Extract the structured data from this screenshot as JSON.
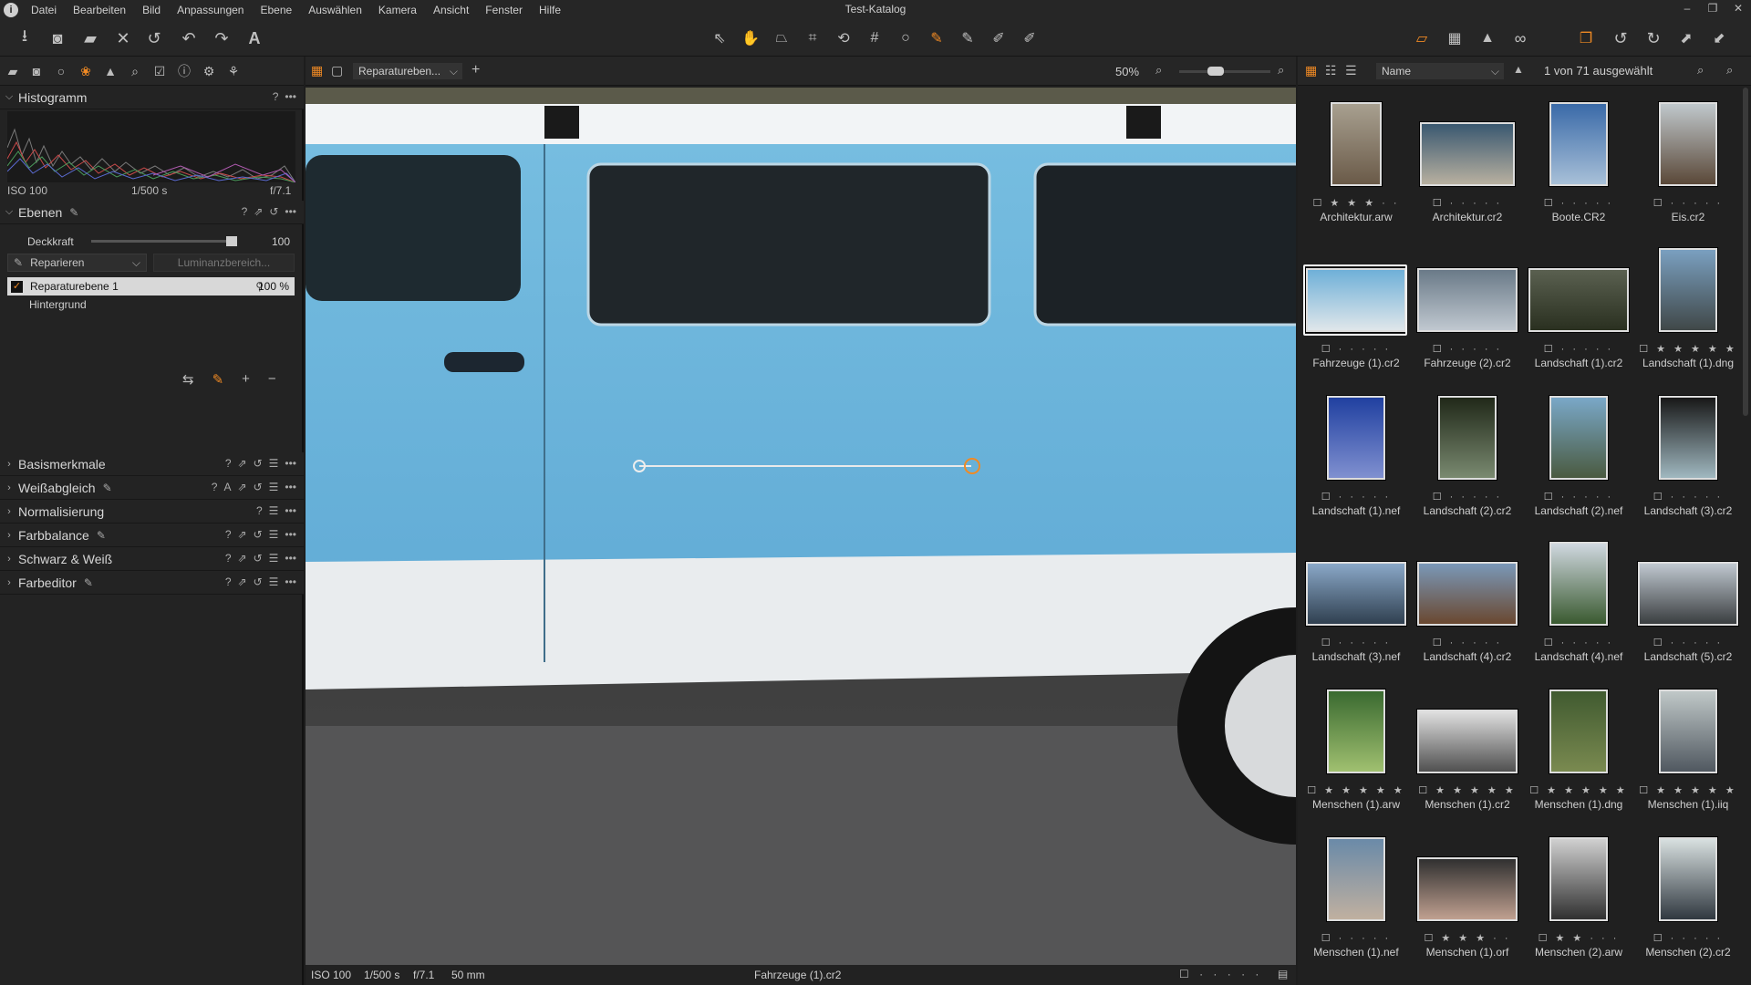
{
  "window": {
    "title": "Test-Katalog"
  },
  "menu": [
    "Datei",
    "Bearbeiten",
    "Bild",
    "Anpassungen",
    "Ebene",
    "Auswählen",
    "Kamera",
    "Ansicht",
    "Fenster",
    "Hilfe"
  ],
  "histogram": {
    "title": "Histogramm",
    "iso": "ISO 100",
    "shutter": "1/500 s",
    "aperture": "f/7.1",
    "help": "?"
  },
  "layers": {
    "title": "Ebenen",
    "opacity_label": "Deckkraft",
    "opacity_value": "100",
    "opacity_fraction": 1.0,
    "mode_select": "Reparieren",
    "luminance_button": "Luminanzbereich...",
    "items": [
      {
        "name": "Reparaturebene 1",
        "value": "100 %",
        "checked": true
      },
      {
        "name": "Hintergrund"
      }
    ]
  },
  "tools": [
    {
      "title": "Basismerkmale"
    },
    {
      "title": "Weißabgleich"
    },
    {
      "title": "Normalisierung"
    },
    {
      "title": "Farbbalance"
    },
    {
      "title": "Schwarz & Weiß"
    },
    {
      "title": "Farbeditor"
    }
  ],
  "viewer": {
    "layer_select": "Reparatureben...",
    "zoom": "50%",
    "zoom_fraction": 0.4
  },
  "status": {
    "iso": "ISO 100",
    "shutter": "1/500 s",
    "aperture": "f/7.1",
    "focal": "50 mm",
    "filename": "Fahrzeuge (1).cr2"
  },
  "browser": {
    "sort": "Name",
    "count": "1 von 71 ausgewählt"
  },
  "thumbnails": [
    {
      "name": "Architektur.arw",
      "stars": "☐ ★ ★ ★ · ·",
      "colors": [
        "#a8a090",
        "#6a5a48"
      ]
    },
    {
      "name": "Architektur.cr2",
      "stars": "☐ · · · · ·",
      "colors": [
        "#3a5870",
        "#b8b0a0"
      ]
    },
    {
      "name": "Boote.CR2",
      "stars": "☐ · · · · ·",
      "colors": [
        "#3a6aa8",
        "#a8c0d8"
      ]
    },
    {
      "name": "Eis.cr2",
      "stars": "☐ · · · · ·",
      "colors": [
        "#c0c8cc",
        "#5a4838"
      ]
    },
    {
      "name": "Fahrzeuge (1).cr2",
      "stars": "☐ · · · · ·",
      "colors": [
        "#6fb0d8",
        "#dfe6ea"
      ],
      "selected": true
    },
    {
      "name": "Fahrzeuge (2).cr2",
      "stars": "☐ · · · · ·",
      "colors": [
        "#6a7a88",
        "#c0c8d0"
      ]
    },
    {
      "name": "Landschaft (1).cr2",
      "stars": "☐ · · · · ·",
      "colors": [
        "#5a6050",
        "#2a3020"
      ]
    },
    {
      "name": "Landschaft (1).dng",
      "stars": "☐ ★ ★ ★ ★ ★",
      "colors": [
        "#7aa0c0",
        "#404848"
      ]
    },
    {
      "name": "Landschaft (1).nef",
      "stars": "☐ · · · · ·",
      "colors": [
        "#2040a0",
        "#8090d0"
      ]
    },
    {
      "name": "Landschaft (2).cr2",
      "stars": "☐ · · · · ·",
      "colors": [
        "#202818",
        "#7a8a70"
      ]
    },
    {
      "name": "Landschaft (2).nef",
      "stars": "☐ · · · · ·",
      "colors": [
        "#7aa8c8",
        "#4a5a40"
      ]
    },
    {
      "name": "Landschaft (3).cr2",
      "stars": "☐ · · · · ·",
      "colors": [
        "#181818",
        "#a0b8c0"
      ]
    },
    {
      "name": "Landschaft (3).nef",
      "stars": "☐ · · · · ·",
      "colors": [
        "#8aa8c8",
        "#304050"
      ]
    },
    {
      "name": "Landschaft (4).cr2",
      "stars": "☐ · · · · ·",
      "colors": [
        "#7a98b8",
        "#6a4830"
      ]
    },
    {
      "name": "Landschaft (4).nef",
      "stars": "☐ · · · · ·",
      "colors": [
        "#d0d8e0",
        "#3a5a30"
      ]
    },
    {
      "name": "Landschaft (5).cr2",
      "stars": "☐ · · · · ·",
      "colors": [
        "#c0c8d0",
        "#3a3e40"
      ]
    },
    {
      "name": "Menschen (1).arw",
      "stars": "☐ ★ ★ ★ ★ ★",
      "colors": [
        "#3a6a30",
        "#a0c070"
      ]
    },
    {
      "name": "Menschen (1).cr2",
      "stars": "☐ ★ ★ ★ ★ ★",
      "colors": [
        "#e0e0e0",
        "#505050"
      ]
    },
    {
      "name": "Menschen (1).dng",
      "stars": "☐ ★ ★ ★ ★ ★",
      "colors": [
        "#405a30",
        "#7a8a50"
      ]
    },
    {
      "name": "Menschen (1).iiq",
      "stars": "☐ ★ ★ ★ ★ ★",
      "colors": [
        "#c0c8c8",
        "#505860"
      ]
    },
    {
      "name": "Menschen (1).nef",
      "stars": "☐ · · · · ·",
      "colors": [
        "#6a8aa8",
        "#c0b0a0"
      ]
    },
    {
      "name": "Menschen (1).orf",
      "stars": "☐ ★ ★ ★ · ·",
      "colors": [
        "#303030",
        "#c0a090"
      ]
    },
    {
      "name": "Menschen (2).arw",
      "stars": "☐ ★ ★ · · ·",
      "colors": [
        "#d0d0d0",
        "#303030"
      ]
    },
    {
      "name": "Menschen (2).cr2",
      "stars": "☐ · · · · ·",
      "colors": [
        "#d8e0e0",
        "#303840"
      ]
    }
  ]
}
